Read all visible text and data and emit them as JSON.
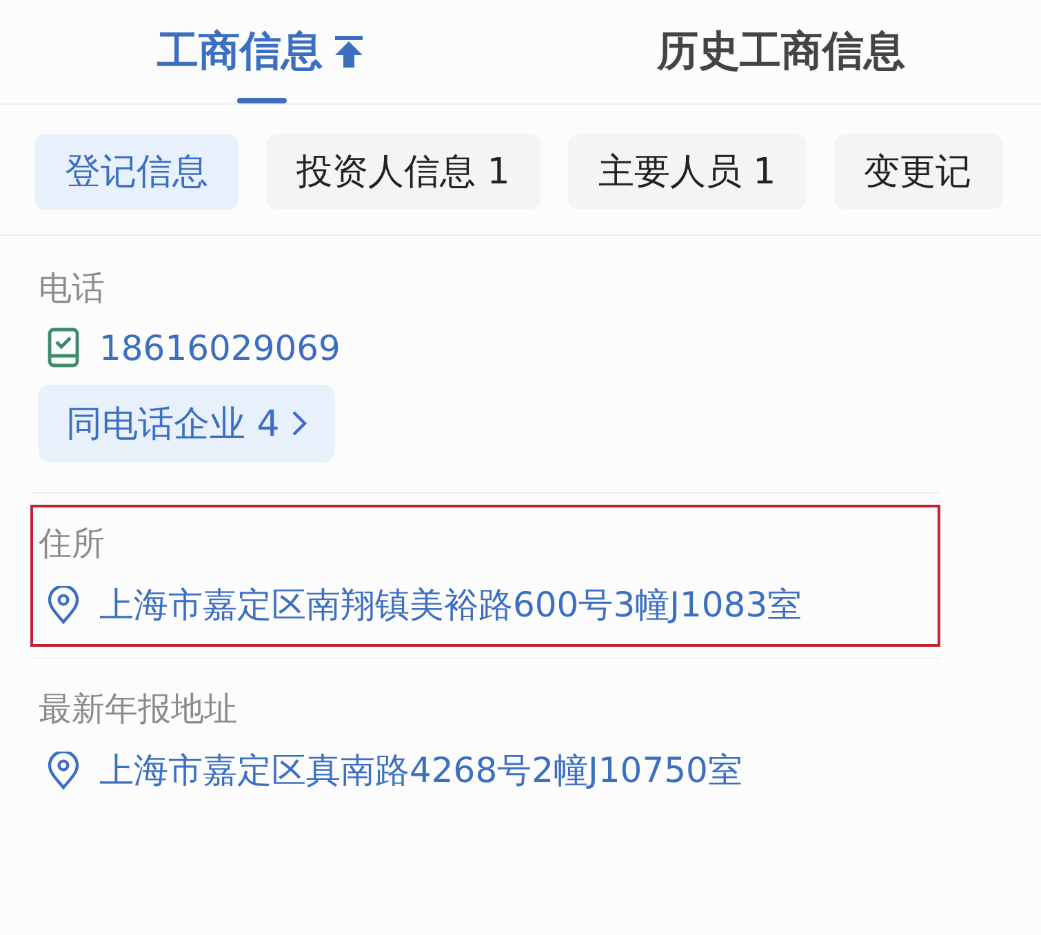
{
  "tabs": [
    {
      "label": "工商信息",
      "selected": true
    },
    {
      "label": "历史工商信息",
      "selected": false
    }
  ],
  "chips": [
    {
      "label": "登记信息",
      "selected": true
    },
    {
      "label": "投资人信息 1",
      "selected": false
    },
    {
      "label": "主要人员 1",
      "selected": false
    },
    {
      "label": "变更记",
      "selected": false
    }
  ],
  "fields": [
    {
      "kind": "phone",
      "label": "电话",
      "value": "18616029069",
      "highlighted": false,
      "related_button": "同电话企业 4"
    },
    {
      "kind": "address",
      "label": "住所",
      "value": "上海市嘉定区南翔镇美裕路600号3幢J1083室",
      "highlighted": true
    },
    {
      "kind": "address",
      "label": "最新年报地址",
      "value": "上海市嘉定区真南路4268号2幢J10750室",
      "highlighted": false
    }
  ]
}
